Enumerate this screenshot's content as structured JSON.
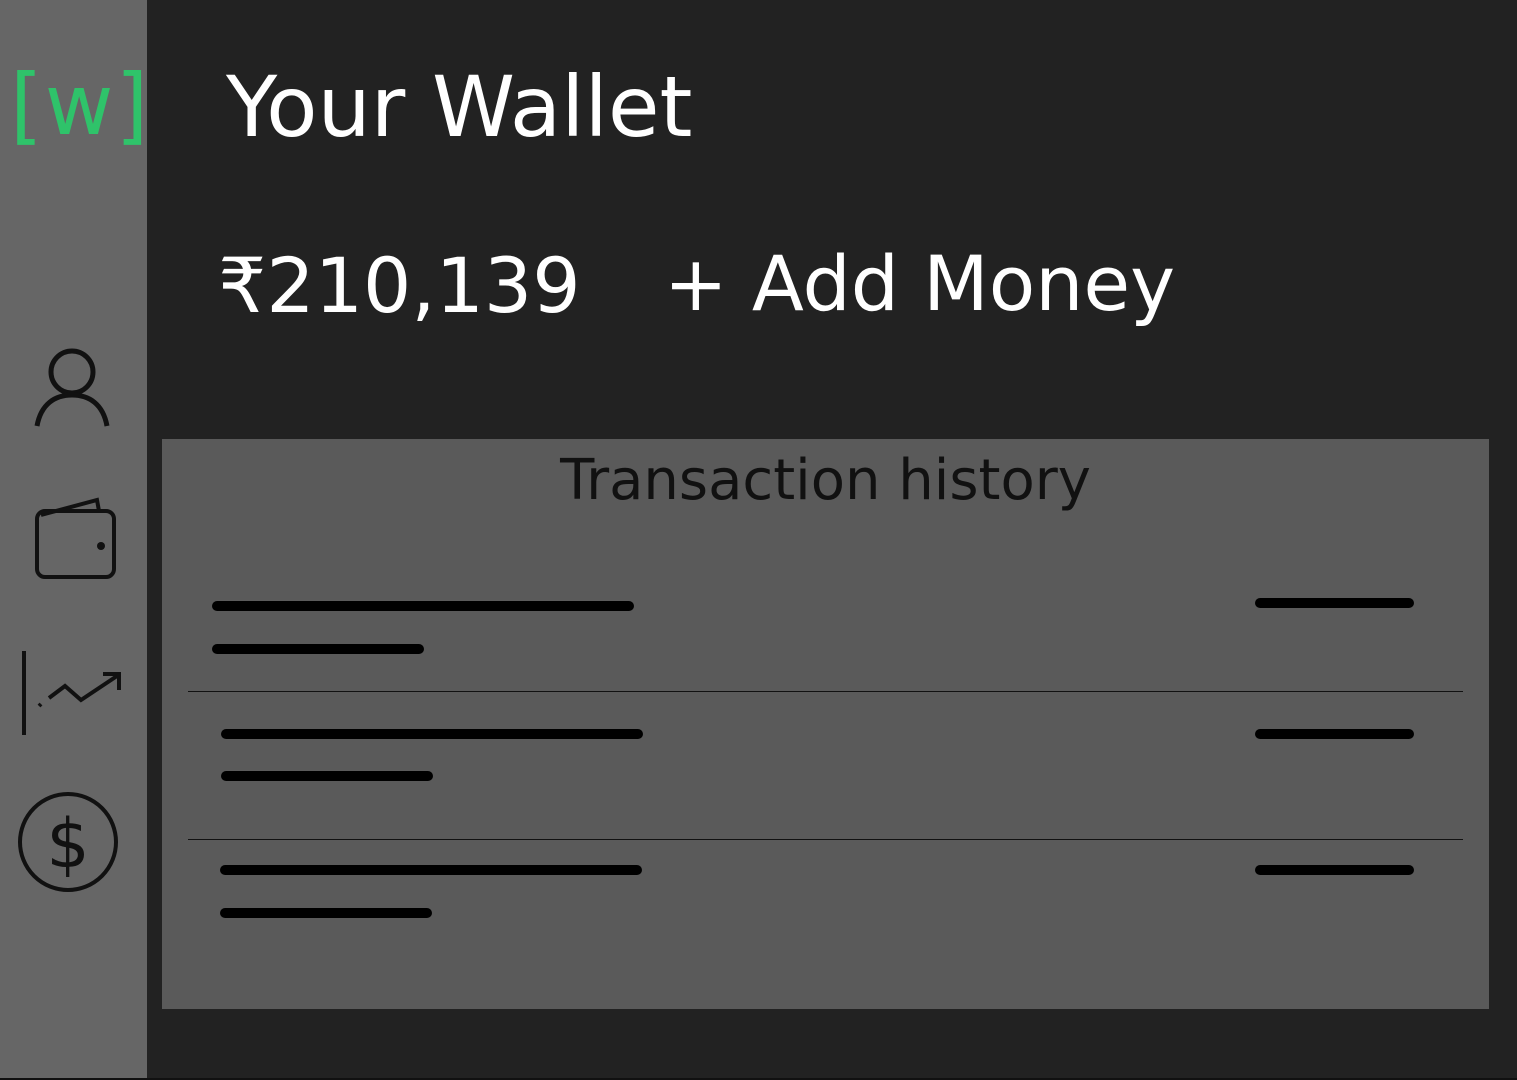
{
  "app": {
    "logo_text": "[w]",
    "logo_color": "#2fc36a"
  },
  "sidebar": {
    "items": [
      {
        "icon": "user-icon"
      },
      {
        "icon": "wallet-icon"
      },
      {
        "icon": "chart-trend-icon"
      },
      {
        "icon": "dollar-icon"
      }
    ]
  },
  "header": {
    "title": "Your Wallet"
  },
  "wallet": {
    "balance": "₹210,139",
    "add_money_label": "+ Add Money"
  },
  "transactions": {
    "title": "Transaction history",
    "rows": [
      {
        "placeholder": true
      },
      {
        "placeholder": true
      },
      {
        "placeholder": true
      }
    ]
  }
}
